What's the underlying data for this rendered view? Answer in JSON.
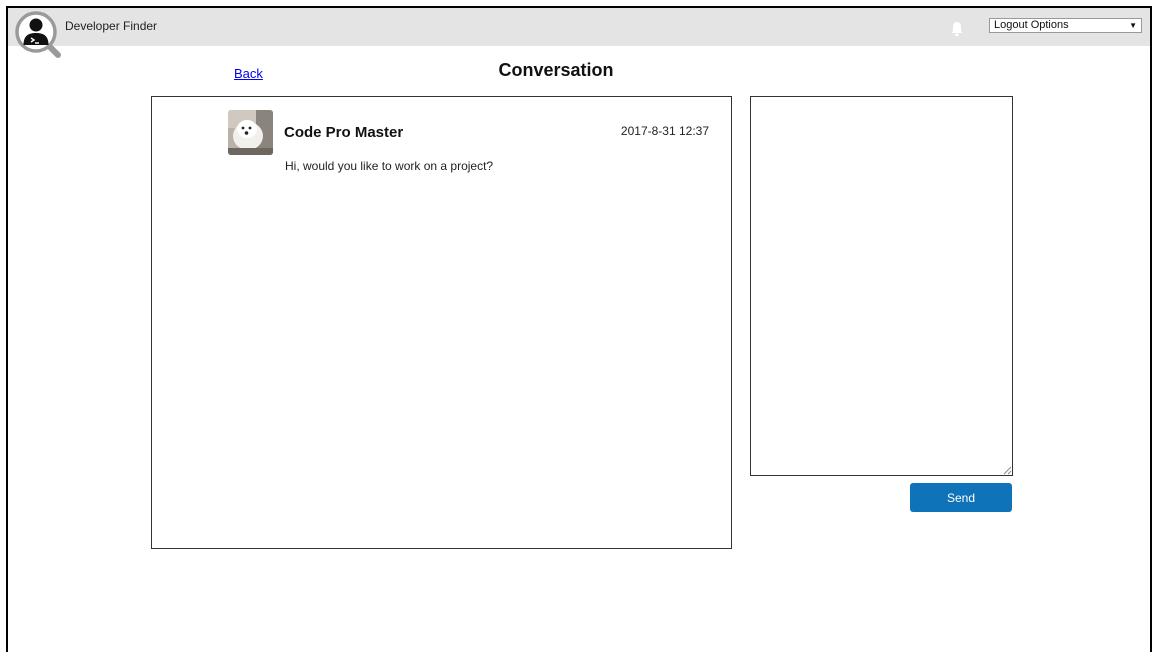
{
  "header": {
    "app_title": "Developer Finder",
    "logout_select": {
      "selected": "Logout Options"
    }
  },
  "page": {
    "back_label": "Back",
    "title": "Conversation"
  },
  "conversation": {
    "messages": [
      {
        "sender": "Code Pro Master",
        "timestamp": "2017-8-31 12:37",
        "text": "Hi, would you like to work on a project?"
      }
    ]
  },
  "reply": {
    "value": "",
    "send_label": "Send"
  },
  "colors": {
    "topbar": "#e4e4e4",
    "send_button": "#0e73b8",
    "link": "#0000ee"
  }
}
